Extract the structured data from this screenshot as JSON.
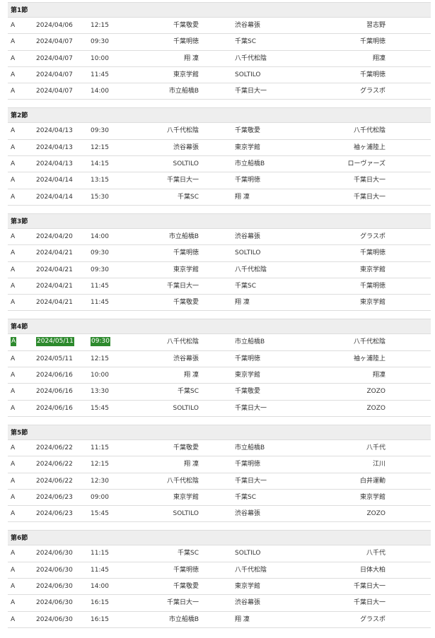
{
  "sections": [
    {
      "title": "第1節",
      "matches": [
        {
          "cat": "A",
          "date": "2024/04/06",
          "time": "12:15",
          "home": "千葉敬愛",
          "away": "渋谷幕張",
          "venue": "習志野"
        },
        {
          "cat": "A",
          "date": "2024/04/07",
          "time": "09:30",
          "home": "千葉明徳",
          "away": "千葉SC",
          "venue": "千葉明徳"
        },
        {
          "cat": "A",
          "date": "2024/04/07",
          "time": "10:00",
          "home": "翔 凜",
          "away": "八千代松陰",
          "venue": "翔凜"
        },
        {
          "cat": "A",
          "date": "2024/04/07",
          "time": "11:45",
          "home": "東京学館",
          "away": "SOLTILO",
          "venue": "千葉明徳"
        },
        {
          "cat": "A",
          "date": "2024/04/07",
          "time": "14:00",
          "home": "市立船橋B",
          "away": "千葉日大一",
          "venue": "グラスポ"
        }
      ]
    },
    {
      "title": "第2節",
      "matches": [
        {
          "cat": "A",
          "date": "2024/04/13",
          "time": "09:30",
          "home": "八千代松陰",
          "away": "千葉敬愛",
          "venue": "八千代松陰"
        },
        {
          "cat": "A",
          "date": "2024/04/13",
          "time": "12:15",
          "home": "渋谷幕張",
          "away": "東京学館",
          "venue": "袖ヶ浦陸上"
        },
        {
          "cat": "A",
          "date": "2024/04/13",
          "time": "14:15",
          "home": "SOLTILO",
          "away": "市立船橋B",
          "venue": "ローヴァーズ"
        },
        {
          "cat": "A",
          "date": "2024/04/14",
          "time": "13:15",
          "home": "千葉日大一",
          "away": "千葉明徳",
          "venue": "千葉日大一"
        },
        {
          "cat": "A",
          "date": "2024/04/14",
          "time": "15:30",
          "home": "千葉SC",
          "away": "翔 凜",
          "venue": "千葉日大一"
        }
      ]
    },
    {
      "title": "第3節",
      "matches": [
        {
          "cat": "A",
          "date": "2024/04/20",
          "time": "14:00",
          "home": "市立船橋B",
          "away": "渋谷幕張",
          "venue": "グラスポ"
        },
        {
          "cat": "A",
          "date": "2024/04/21",
          "time": "09:30",
          "home": "千葉明徳",
          "away": "SOLTILO",
          "venue": "千葉明徳"
        },
        {
          "cat": "A",
          "date": "2024/04/21",
          "time": "09:30",
          "home": "東京学館",
          "away": "八千代松陰",
          "venue": "東京学館"
        },
        {
          "cat": "A",
          "date": "2024/04/21",
          "time": "11:45",
          "home": "千葉日大一",
          "away": "千葉SC",
          "venue": "千葉明徳"
        },
        {
          "cat": "A",
          "date": "2024/04/21",
          "time": "11:45",
          "home": "千葉敬愛",
          "away": "翔 凜",
          "venue": "東京学館"
        }
      ]
    },
    {
      "title": "第4節",
      "matches": [
        {
          "cat": "A",
          "date": "2024/05/11",
          "time": "09:30",
          "home": "八千代松陰",
          "away": "市立船橋B",
          "venue": "八千代松陰",
          "highlight": true
        },
        {
          "cat": "A",
          "date": "2024/05/11",
          "time": "12:15",
          "home": "渋谷幕張",
          "away": "千葉明徳",
          "venue": "袖ヶ浦陸上"
        },
        {
          "cat": "A",
          "date": "2024/06/16",
          "time": "10:00",
          "home": "翔 凜",
          "away": "東京学館",
          "venue": "翔凜"
        },
        {
          "cat": "A",
          "date": "2024/06/16",
          "time": "13:30",
          "home": "千葉SC",
          "away": "千葉敬愛",
          "venue": "ZOZO"
        },
        {
          "cat": "A",
          "date": "2024/06/16",
          "time": "15:45",
          "home": "SOLTILO",
          "away": "千葉日大一",
          "venue": "ZOZO"
        }
      ]
    },
    {
      "title": "第5節",
      "matches": [
        {
          "cat": "A",
          "date": "2024/06/22",
          "time": "11:15",
          "home": "千葉敬愛",
          "away": "市立船橋B",
          "venue": "八千代"
        },
        {
          "cat": "A",
          "date": "2024/06/22",
          "time": "12:15",
          "home": "翔 凜",
          "away": "千葉明徳",
          "venue": "江川"
        },
        {
          "cat": "A",
          "date": "2024/06/22",
          "time": "12:30",
          "home": "八千代松陰",
          "away": "千葉日大一",
          "venue": "白井運動"
        },
        {
          "cat": "A",
          "date": "2024/06/23",
          "time": "09:00",
          "home": "東京学館",
          "away": "千葉SC",
          "venue": "東京学館"
        },
        {
          "cat": "A",
          "date": "2024/06/23",
          "time": "15:45",
          "home": "SOLTILO",
          "away": "渋谷幕張",
          "venue": "ZOZO"
        }
      ]
    },
    {
      "title": "第6節",
      "matches": [
        {
          "cat": "A",
          "date": "2024/06/30",
          "time": "11:15",
          "home": "千葉SC",
          "away": "SOLTILO",
          "venue": "八千代"
        },
        {
          "cat": "A",
          "date": "2024/06/30",
          "time": "11:45",
          "home": "千葉明徳",
          "away": "八千代松陰",
          "venue": "日体大柏"
        },
        {
          "cat": "A",
          "date": "2024/06/30",
          "time": "14:00",
          "home": "千葉敬愛",
          "away": "東京学館",
          "venue": "千葉日大一"
        },
        {
          "cat": "A",
          "date": "2024/06/30",
          "time": "16:15",
          "home": "千葉日大一",
          "away": "渋谷幕張",
          "venue": "千葉日大一"
        },
        {
          "cat": "A",
          "date": "2024/06/30",
          "time": "16:15",
          "home": "市立船橋B",
          "away": "翔 凜",
          "venue": "グラスポ"
        }
      ]
    }
  ],
  "colors": {
    "highlight": "#2d8a2d",
    "header_bg": "#eeeeee",
    "border": "#dddddd"
  }
}
